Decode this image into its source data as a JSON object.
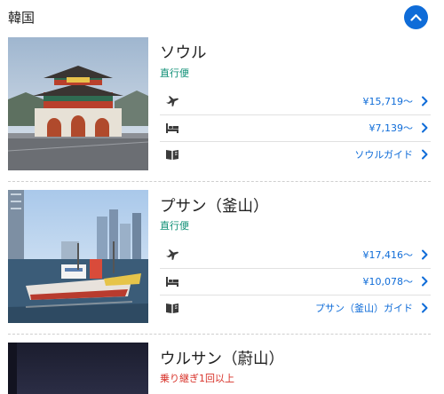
{
  "section": {
    "title": "韓国",
    "collapse_icon": "chevron-up-icon",
    "accent": "#0f6cd8"
  },
  "destinations": [
    {
      "name": "ソウル",
      "route": "直行便",
      "flight_price": "¥15,719～",
      "hotel_price": "¥7,139～",
      "guide_label": "ソウルガイド"
    },
    {
      "name": "プサン（釜山）",
      "route": "直行便",
      "flight_price": "¥17,416～",
      "hotel_price": "¥10,078～",
      "guide_label": "プサン（釜山）ガイド"
    },
    {
      "name": "ウルサン（蔚山）",
      "route": "乗り継ぎ1回以上"
    }
  ],
  "icons": {
    "flight": "airplane-icon",
    "hotel": "bed-icon",
    "guide": "book-icon",
    "chevron": "chevron-right-icon"
  },
  "colors": {
    "direct": "#0f8f76",
    "transfer": "#d8332a",
    "link": "#0f6cd8"
  }
}
